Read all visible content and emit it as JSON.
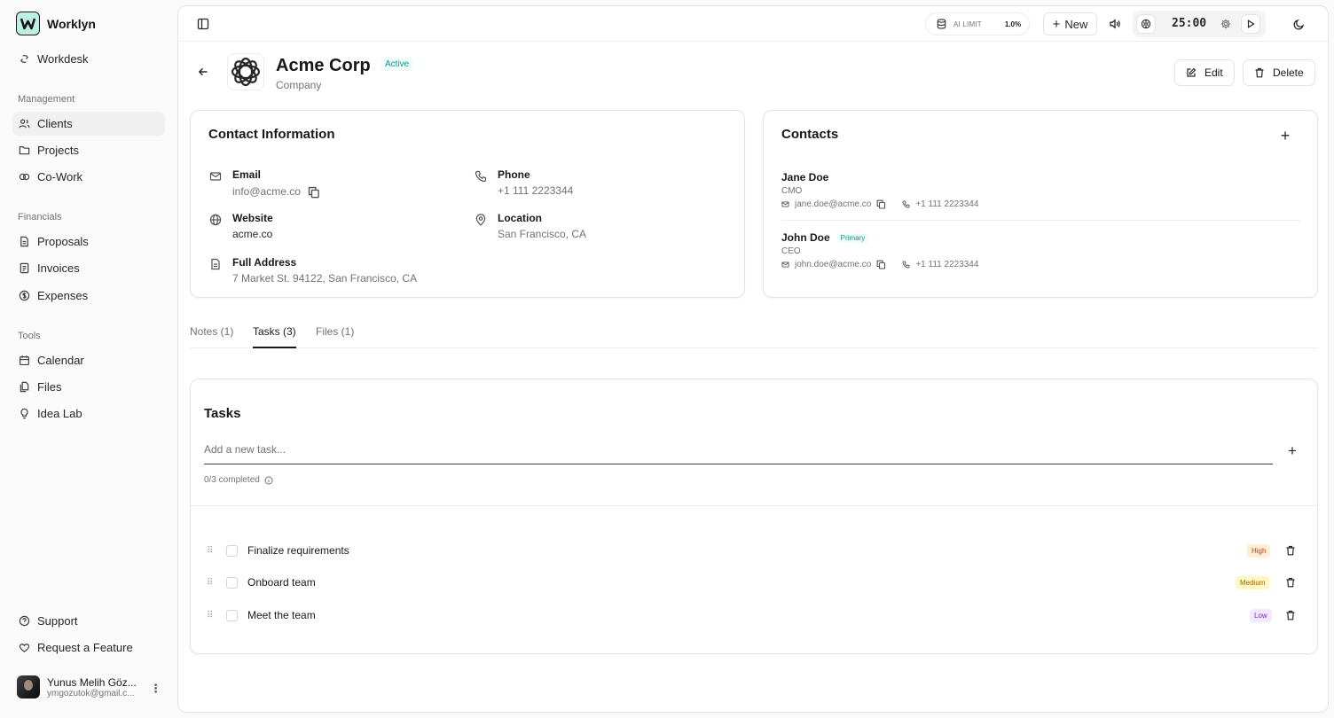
{
  "app": {
    "name": "Worklyn"
  },
  "sidebar": {
    "workdesk": "Workdesk",
    "groups": {
      "management": "Management",
      "financials": "Financials",
      "tools": "Tools"
    },
    "items": {
      "clients": "Clients",
      "projects": "Projects",
      "cowork": "Co-Work",
      "proposals": "Proposals",
      "invoices": "Invoices",
      "expenses": "Expenses",
      "calendar": "Calendar",
      "files": "Files",
      "idealab": "Idea Lab"
    },
    "support": "Support",
    "request_feature": "Request a Feature",
    "user": {
      "name": "Yunus Melih Göz...",
      "email": "ymgozutok@gmail.c..."
    }
  },
  "topbar": {
    "ai_limit_label": "AI LIMIT",
    "ai_limit_value": "1.0%",
    "new_label": "New",
    "timer": "25:00"
  },
  "company": {
    "name": "Acme Corp",
    "status": "Active",
    "type": "Company",
    "edit_label": "Edit",
    "delete_label": "Delete"
  },
  "contact_info": {
    "title": "Contact Information",
    "email_label": "Email",
    "email": "info@acme.co",
    "phone_label": "Phone",
    "phone": "+1 111 2223344",
    "website_label": "Website",
    "website": "acme.co",
    "location_label": "Location",
    "location": "San Francisco, CA",
    "address_label": "Full Address",
    "address": "7 Market St. 94122, San Francisco, CA"
  },
  "contacts": {
    "title": "Contacts",
    "list": [
      {
        "name": "Jane Doe",
        "role": "CMO",
        "email": "jane.doe@acme.co",
        "phone": "+1 111 2223344"
      },
      {
        "name": "John Doe",
        "badge": "Primary",
        "role": "CEO",
        "email": "john.doe@acme.co",
        "phone": "+1 111 2223344"
      }
    ]
  },
  "tabs": {
    "notes": "Notes (1)",
    "tasks": "Tasks (3)",
    "files": "Files (1)"
  },
  "tasks": {
    "title": "Tasks",
    "placeholder": "Add a new task...",
    "completed": "0/3 completed",
    "list": [
      {
        "name": "Finalize requirements",
        "priority": "High"
      },
      {
        "name": "Onboard team",
        "priority": "Medium"
      },
      {
        "name": "Meet the team",
        "priority": "Low"
      }
    ]
  },
  "colors": {
    "active_badge": "#0d9488",
    "priority_high_bg": "#ffedd5",
    "priority_medium_bg": "#fef9c3",
    "priority_low_bg": "#f3e8ff",
    "brand_bg": "#bfeee2"
  }
}
